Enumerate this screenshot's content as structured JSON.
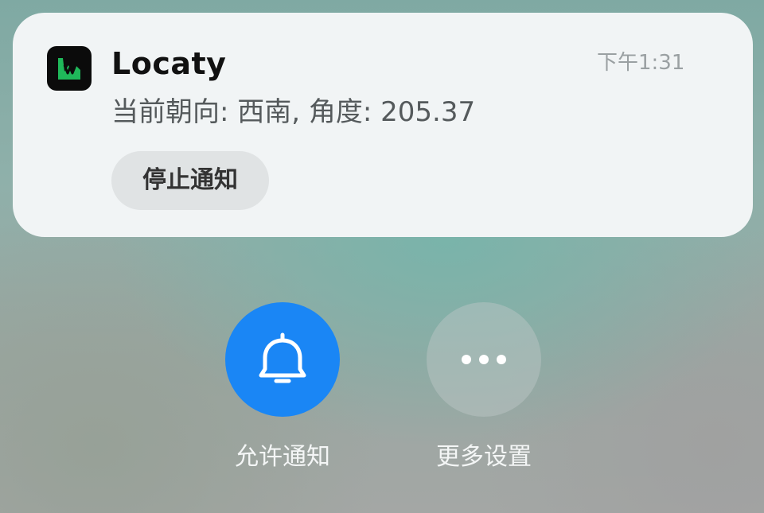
{
  "notification": {
    "app_icon": "locaty-app-icon",
    "app_name": "Locaty",
    "time": "下午1:31",
    "body": "当前朝向: 西南, 角度: 205.37",
    "stop_button_label": "停止通知"
  },
  "actions": {
    "allow": {
      "icon": "bell-icon",
      "label": "允许通知",
      "color": "#1a86f5"
    },
    "more": {
      "icon": "more-dots-icon",
      "label": "更多设置"
    }
  },
  "colors": {
    "card_background": "#f1f4f5",
    "app_icon_green": "#1fb85a",
    "accent_blue": "#1a86f5"
  }
}
